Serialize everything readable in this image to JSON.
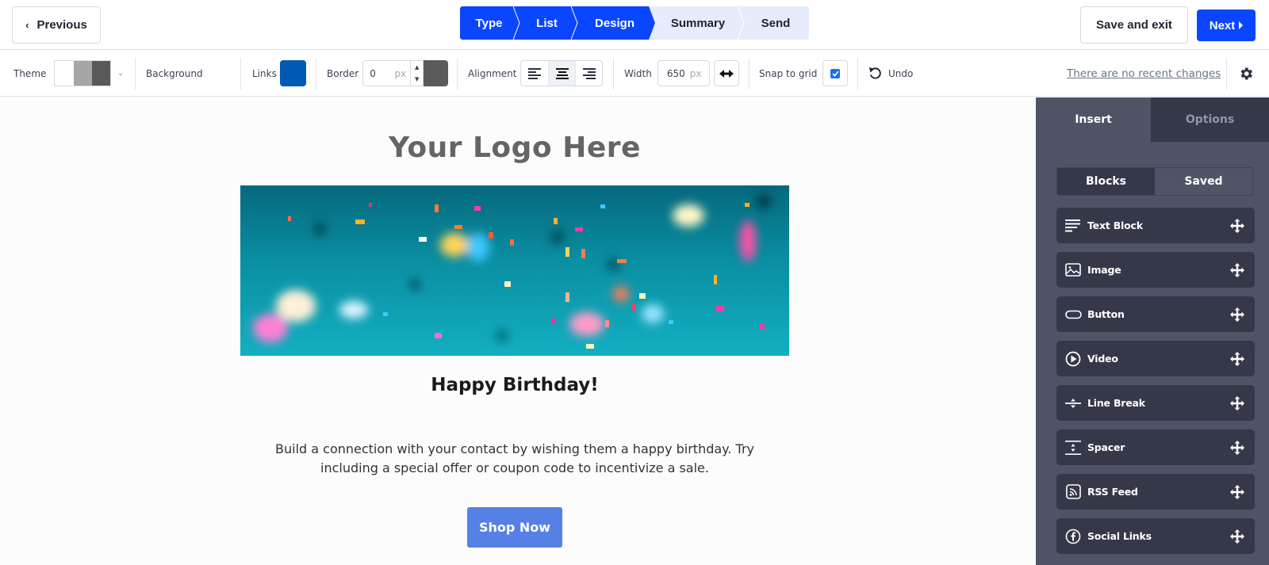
{
  "header": {
    "previous_label": "Previous",
    "steps": [
      {
        "label": "Type",
        "state": "done"
      },
      {
        "label": "List",
        "state": "done"
      },
      {
        "label": "Design",
        "state": "current"
      },
      {
        "label": "Summary",
        "state": "todo"
      },
      {
        "label": "Send",
        "state": "todo"
      }
    ],
    "save_exit_label": "Save and exit",
    "next_label": "Next"
  },
  "toolbar": {
    "theme_label": "Theme",
    "theme_colors": [
      "#ffffff",
      "#a6a6a6",
      "#595959"
    ],
    "background_label": "Background",
    "links_label": "Links",
    "links_color": "#0059b3",
    "border_label": "Border",
    "border_value": "0",
    "border_unit": "px",
    "border_color": "#5a5a5a",
    "alignment_label": "Alignment",
    "alignment_options": [
      "left",
      "center",
      "right"
    ],
    "alignment_selected": "center",
    "width_label": "Width",
    "width_value": "650",
    "width_unit": "px",
    "snap_label": "Snap to grid",
    "snap_checked": true,
    "undo_label": "Undo",
    "recent_changes": "There are no recent changes"
  },
  "email": {
    "logo_text": "Your Logo Here",
    "hero_image": "confetti-image",
    "headline": "Happy Birthday!",
    "body": "Build a connection with your contact by wishing them a happy birthday. Try including a special offer or coupon code to incentivize a sale.",
    "cta_label": "Shop Now",
    "cta_color": "#5581e6"
  },
  "panel": {
    "tabs": [
      {
        "label": "Insert",
        "active": true
      },
      {
        "label": "Options",
        "active": false
      }
    ],
    "segments": [
      {
        "label": "Blocks",
        "active": true
      },
      {
        "label": "Saved",
        "active": false
      }
    ],
    "blocks": [
      {
        "label": "Text Block",
        "icon": "text-lines-icon"
      },
      {
        "label": "Image",
        "icon": "image-icon"
      },
      {
        "label": "Button",
        "icon": "button-icon"
      },
      {
        "label": "Video",
        "icon": "play-icon"
      },
      {
        "label": "Line Break",
        "icon": "line-break-icon"
      },
      {
        "label": "Spacer",
        "icon": "spacer-icon"
      },
      {
        "label": "RSS Feed",
        "icon": "rss-icon"
      },
      {
        "label": "Social Links",
        "icon": "facebook-icon"
      }
    ]
  },
  "colors": {
    "primary": "#0a46ff",
    "step_inactive": "#e6ecfb",
    "panel_bg": "#4e5366",
    "panel_block_bg": "#353849"
  }
}
